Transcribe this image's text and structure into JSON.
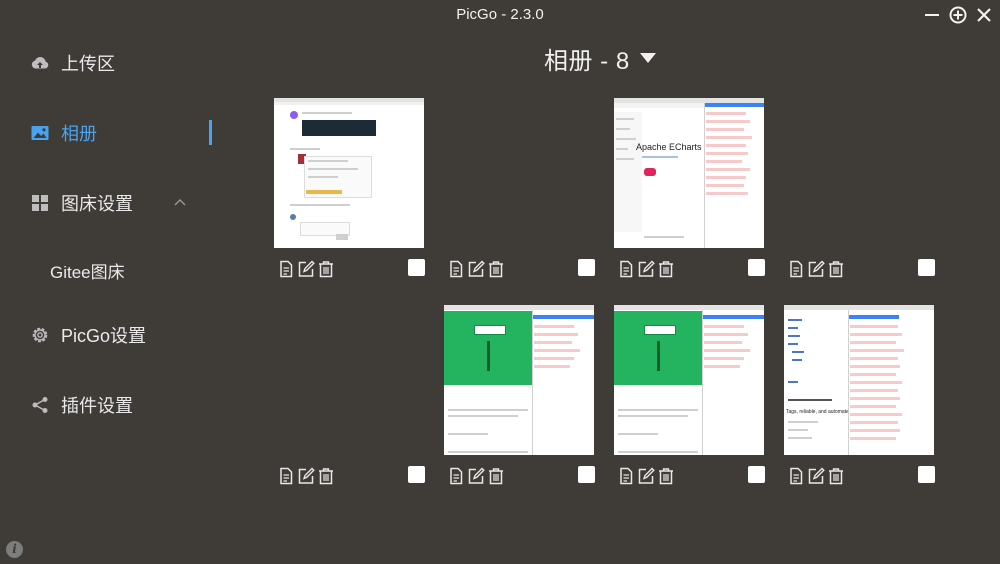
{
  "app": {
    "title": "PicGo - 2.3.0"
  },
  "window_controls": [
    "minimize-icon",
    "maximize-icon",
    "close-icon"
  ],
  "sidebar": {
    "items": [
      {
        "label": "上传区",
        "icon": "cloud-upload-icon"
      },
      {
        "label": "相册",
        "icon": "image-icon",
        "active": true
      },
      {
        "label": "图床设置",
        "icon": "grid-icon"
      },
      {
        "label": "Gitee图床",
        "sub": true
      },
      {
        "label": "PicGo设置",
        "icon": "gear-icon"
      },
      {
        "label": "插件设置",
        "icon": "share-icon"
      }
    ],
    "info_icon": "i"
  },
  "gallery": {
    "title": "相册 - 8",
    "accent": "#4aa3ee",
    "images": [
      {
        "preview": "chat-screenshot"
      },
      {
        "preview": "empty"
      },
      {
        "preview": "echarts-screenshot",
        "text": "Apache ECharts"
      },
      {
        "preview": "empty"
      },
      {
        "preview": "empty"
      },
      {
        "preview": "green-page-screenshot"
      },
      {
        "preview": "green-page-screenshot"
      },
      {
        "preview": "text-list-screenshot",
        "text": "Tags, reliable, and automated"
      }
    ],
    "actions": [
      "document-icon",
      "edit-icon",
      "delete-icon"
    ]
  }
}
